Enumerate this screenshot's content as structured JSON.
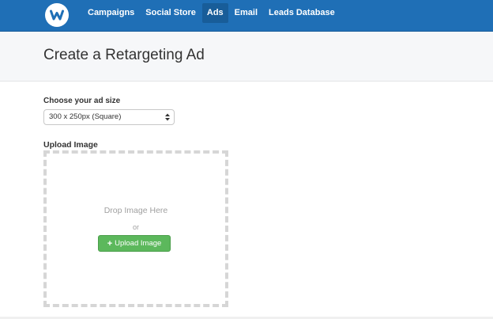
{
  "nav": {
    "logo_icon": "w-logo-icon",
    "items": [
      {
        "label": "Campaigns",
        "active": false
      },
      {
        "label": "Social Store",
        "active": false
      },
      {
        "label": "Ads",
        "active": true
      },
      {
        "label": "Email",
        "active": false
      },
      {
        "label": "Leads Database",
        "active": false
      }
    ]
  },
  "page": {
    "title": "Create a Retargeting Ad"
  },
  "ad_size": {
    "label": "Choose your ad size",
    "selected": "300 x 250px (Square)"
  },
  "upload": {
    "label": "Upload Image",
    "drop_text": "Drop Image Here",
    "or_text": "or",
    "button_icon": "plus-icon",
    "button_label": "Upload Image"
  },
  "colors": {
    "nav_background": "#1f6fb6",
    "upload_button": "#5cb85c"
  }
}
